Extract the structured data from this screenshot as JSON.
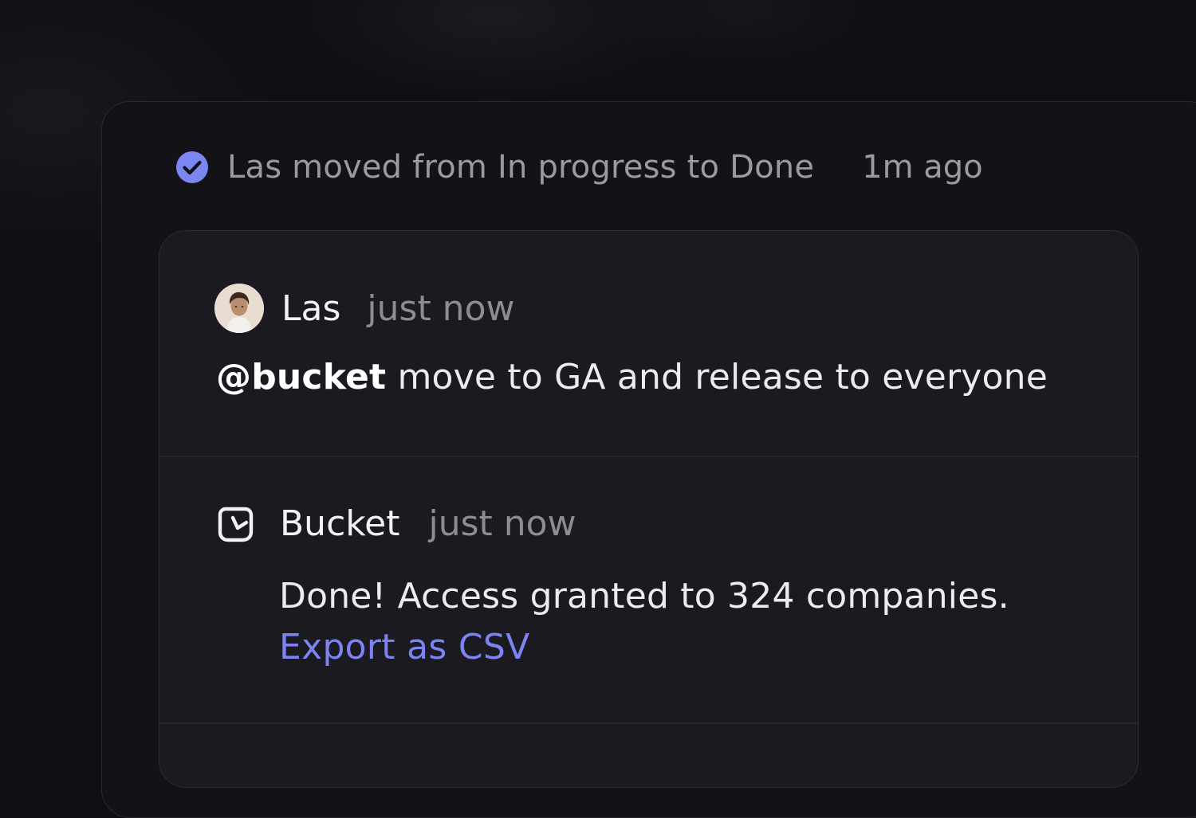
{
  "activity": {
    "icon": "check-circle-icon",
    "text": "Las moved from In progress to Done",
    "time": "1m ago",
    "accent_color": "#7b86f2"
  },
  "comments": [
    {
      "author": "Las",
      "time": "just now",
      "avatar": "user-avatar",
      "mention": "@bucket",
      "text": " move to GA and release to everyone"
    },
    {
      "author": "Bucket",
      "time": "just now",
      "icon": "bucket-logo-icon",
      "text": "Done! Access granted to 324 companies.",
      "link_label": "Export as CSV",
      "link_color": "#7c83f2"
    }
  ]
}
